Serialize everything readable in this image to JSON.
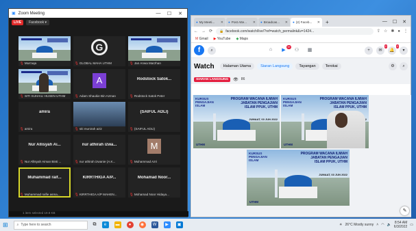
{
  "zoom": {
    "title": "Zoom Meeting",
    "live": "LIVE",
    "facebook": "Facebook",
    "tiles": [
      {
        "name": "Mus'aqa",
        "type": "mosque"
      },
      {
        "name": "GLOBAL MAHA UTHM",
        "type": "logo"
      },
      {
        "name": "Jan Anwa Marzhan",
        "type": "mosque"
      },
      {
        "name": "SITI SUHAILI HUSEN UTHM",
        "type": "person"
      },
      {
        "name": "Adam Shaukie Bin Azman",
        "type": "avatar",
        "initial": "A",
        "color": "#7b3fd4"
      },
      {
        "name": "Rodstock Satok Peter",
        "type": "text",
        "big": "Rodstock Satok..."
      },
      {
        "name": "amira",
        "type": "text",
        "big": "amira"
      },
      {
        "name": "siti munirah aziz",
        "type": "person2"
      },
      {
        "name": "(SAIFUL ADLI)",
        "type": "text",
        "big": "(SAIFUL ADLI)"
      },
      {
        "name": "Nur Allisyah Aiman Binti ...",
        "type": "text",
        "big": "Nur Allisyah Ai..."
      },
      {
        "name": "nur athirah izwanie (A.K...",
        "type": "text",
        "big": "nur athirah izwa..."
      },
      {
        "name": "Muhammad Azri",
        "type": "avatar",
        "initial": "M",
        "color": "#a27c6a"
      },
      {
        "name": "Muhammad raifie asma...",
        "type": "text",
        "big": "Muhammad raif...",
        "hl": true
      },
      {
        "name": "KIRRTHIGA A/P MAHEN...",
        "type": "text",
        "big": "KIRRTHIGA A/P..."
      },
      {
        "name": "Mohamad Noor Hidaya...",
        "type": "text",
        "big": "Mohamad Noor..."
      }
    ],
    "footer": "1 item selected  19.8 KB"
  },
  "browser": {
    "tabs": [
      {
        "label": "My Meeti..."
      },
      {
        "label": "Post Atte..."
      },
      {
        "label": "Broadcas..."
      },
      {
        "label": "(2) Faceb...",
        "active": true
      }
    ],
    "url": "facebook.com/watch/live/?ref=watch_permalink&v=1424...",
    "bookmarks": [
      "Gmail",
      "YouTube",
      "Maps"
    ]
  },
  "facebook": {
    "watch_title": "Watch",
    "pills": [
      "Halaman Utama",
      "Siaran Langsung",
      "Tayangan",
      "Terokai"
    ],
    "active_pill": "Siaran Langsung",
    "live_tag": "SIARAN LANGSUNG",
    "views": "86",
    "badge_video": "9+",
    "badge_msg": "2",
    "badge_notif": "2"
  },
  "slides": {
    "left_title": "KURSUS PENGAJIAN ISLAM",
    "main_title": "PROGRAM WACANA ILMIAH JABATAN PENGAJIAN ISLAM PPUK, UTHM",
    "date": "JUMAAT, 03 JUN 2022",
    "brand": "UTHM"
  },
  "taskbar": {
    "search_placeholder": "Type here to search",
    "weather": "26°C  Mostly sunny",
    "time": "8:54 AM",
    "date": "6/3/2022"
  }
}
